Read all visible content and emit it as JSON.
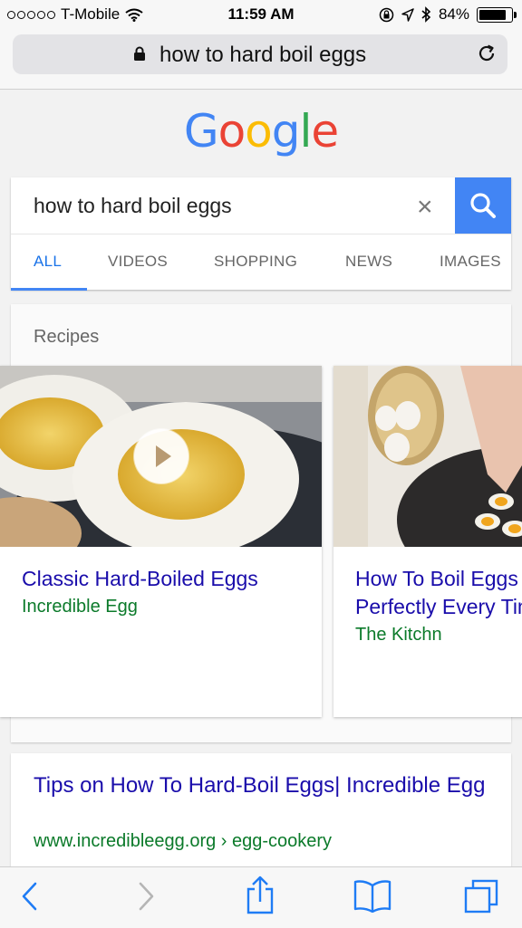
{
  "status": {
    "carrier": "T-Mobile",
    "time": "11:59 AM",
    "battery": "84%",
    "battery_level": 0.84
  },
  "browser": {
    "address": "how to hard boil eggs",
    "icons": [
      "lock-icon",
      "reload-icon"
    ]
  },
  "logo": {
    "letters": [
      {
        "ch": "G",
        "color": "#4285f4"
      },
      {
        "ch": "o",
        "color": "#ea4335"
      },
      {
        "ch": "o",
        "color": "#fbbc05"
      },
      {
        "ch": "g",
        "color": "#4285f4"
      },
      {
        "ch": "l",
        "color": "#34a853"
      },
      {
        "ch": "e",
        "color": "#ea4335"
      }
    ]
  },
  "search": {
    "query": "how to hard boil eggs",
    "clear_icon": "×",
    "tabs": [
      "ALL",
      "VIDEOS",
      "SHOPPING",
      "NEWS",
      "IMAGES"
    ],
    "active_tab": "ALL"
  },
  "recipes": {
    "heading": "Recipes",
    "items": [
      {
        "title": "Classic Hard-Boiled Eggs",
        "source": "Incredible Egg"
      },
      {
        "title_line1": "How To Boil Eggs",
        "title_line2": "Perfectly Every Time",
        "source": "The Kitchn"
      }
    ]
  },
  "result": {
    "title": "Tips on How To Hard-Boil Eggs| Incredible Egg",
    "url": "www.incredibleegg.org › egg-cookery"
  },
  "colors": {
    "accent": "#4285f4",
    "link": "#1a0dab",
    "url_green": "#0b7a2a",
    "toolbar_blue": "#1f7cf5"
  }
}
